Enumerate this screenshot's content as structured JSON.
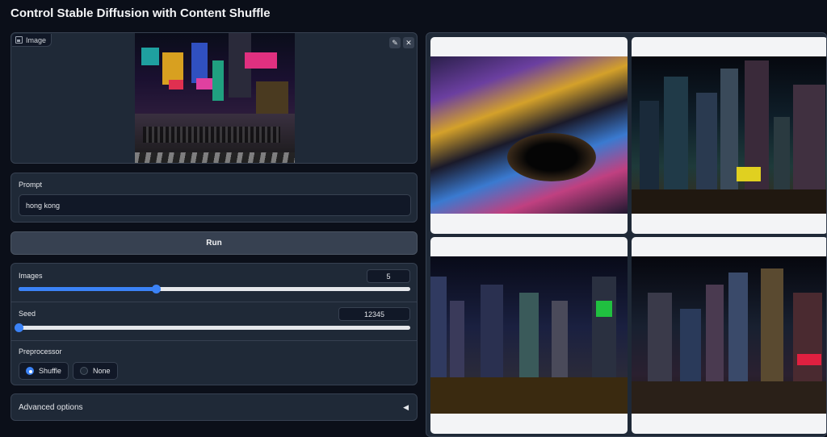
{
  "app": {
    "title": "Control Stable Diffusion with Content Shuffle"
  },
  "image_input": {
    "label": "Image",
    "label_icon": "image-icon",
    "edit_icon": "pencil-icon",
    "clear_icon": "close-icon"
  },
  "prompt": {
    "label": "Prompt",
    "value": "hong kong"
  },
  "run_button": {
    "label": "Run"
  },
  "images": {
    "label": "Images",
    "value": "5",
    "fraction": 0.35
  },
  "seed": {
    "label": "Seed",
    "value": "12345",
    "fraction": 0.0
  },
  "preprocessor": {
    "label": "Preprocessor",
    "options": [
      {
        "label": "Shuffle",
        "selected": true
      },
      {
        "label": "None",
        "selected": false
      }
    ]
  },
  "advanced": {
    "label": "Advanced options",
    "icon": "triangle-left-icon"
  },
  "colors": {
    "accent": "#3b82f6",
    "background": "#0b0f19",
    "panel": "#1f2937"
  }
}
